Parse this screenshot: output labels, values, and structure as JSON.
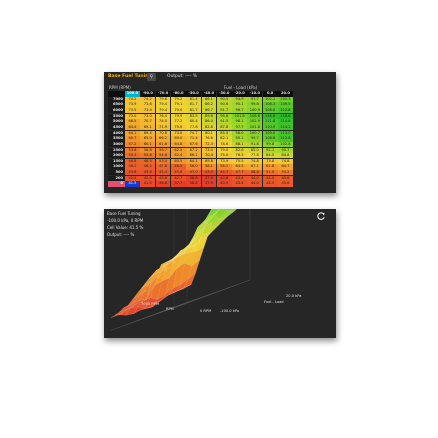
{
  "table": {
    "title": "Base Fuel Tuning",
    "output_label": "Output: ---- %",
    "rpm_axis_label": "RPM (RPM)",
    "load_axis_label": "Fuel - Load (kPa)",
    "columns": [
      "100.0",
      "-90.0",
      "-70.0",
      "-60.0",
      "-50.0",
      "-40.0",
      "-30.0",
      "-20.0",
      "-10.0",
      "0.0",
      "20.0"
    ],
    "selected_column": 0,
    "selected_row": 15,
    "rows": [
      {
        "rpm": "7000",
        "values": [
          "74.2",
          "74.2",
          "79.8",
          "79.2",
          "81.4",
          "86.1",
          "90.5",
          "94.9",
          "97.7",
          "102.2",
          "105.3"
        ]
      },
      {
        "rpm": "6500",
        "values": [
          "73.9",
          "73.8",
          "79.4",
          "79.1",
          "81.7",
          "86.2",
          "90.6",
          "95.1",
          "99.8",
          "108.3",
          "109.5"
        ]
      },
      {
        "rpm": "6000",
        "values": [
          "73.5",
          "73.4",
          "79.4",
          "79.0",
          "81.7",
          "86.7",
          "91.7",
          "96.7",
          "100.9",
          "108.8",
          "112.8"
        ]
      },
      {
        "rpm": "5500",
        "values": [
          "73.0",
          "73.0",
          "76.4",
          "79.9",
          "83.5",
          "89.6",
          "95.6",
          "101.8",
          "106.8",
          "116.8",
          "118.6"
        ]
      },
      {
        "rpm": "5000",
        "values": [
          "66.5",
          "70.7",
          "74.0",
          "77.2",
          "80.4",
          "86.0",
          "91.5",
          "98.1",
          "102.9",
          "111.8",
          "114.8"
        ]
      },
      {
        "rpm": "4500",
        "values": [
          "64.4",
          "69.1",
          "71.9",
          "75.0",
          "77.8",
          "82.8",
          "87.8",
          "97.7",
          "101.8",
          "110.9",
          "114.2"
        ]
      },
      {
        "rpm": "4000",
        "values": [
          "64.1",
          "69.4",
          "70.8",
          "73.0",
          "74.7",
          "80.1",
          "85.5",
          "96.0",
          "100.7",
          "109.0",
          "113.0"
        ]
      },
      {
        "rpm": "3500",
        "values": [
          "60.7",
          "65.0",
          "66.2",
          "69.0",
          "71.4",
          "76.6",
          "82.1",
          "95.1",
          "99.7",
          "108.8",
          "112.8"
        ]
      },
      {
        "rpm": "3000",
        "values": [
          "57.2",
          "60.1",
          "61.6",
          "64.8",
          "67.6",
          "72.3",
          "78.6",
          "88.1",
          "91.8",
          "99.8",
          "102.8"
        ]
      },
      {
        "rpm": "2500",
        "values": [
          "53.8",
          "58.8",
          "58.7",
          "62.5",
          "67.2",
          "73.0",
          "79.0",
          "82.6",
          "85.0",
          "92.1",
          "95.7"
        ]
      },
      {
        "rpm": "2000",
        "values": [
          "50.3",
          "52.8",
          "54.8",
          "62.4",
          "66.1",
          "70.4",
          "75.0",
          "76.5",
          "77.8",
          "84.5",
          "84.8"
        ]
      },
      {
        "rpm": "1500",
        "values": [
          "46.8",
          "48.5",
          "53.0",
          "60.5",
          "64.1",
          "69.8",
          "73.9",
          "75.5",
          "74.8",
          "73.8",
          "74.8"
        ]
      },
      {
        "rpm": "1000",
        "values": [
          "46.2",
          "46.2",
          "47.8",
          "46.5",
          "56.0",
          "58.1",
          "58.2",
          "64.5",
          "67.1",
          "61.8",
          "64.7"
        ]
      },
      {
        "rpm": "500",
        "values": [
          "43.8",
          "43.8",
          "45.4",
          "45.8",
          "47.0",
          "43.0",
          "44.7",
          "47.7",
          "48.8",
          "51.0",
          "54.2"
        ]
      },
      {
        "rpm": "200",
        "values": [
          "42.4",
          "42.4",
          "43.8",
          "42.7",
          "38.8",
          "37.9",
          "40.8",
          "43.4",
          "44.0",
          "44.5",
          "45.6"
        ]
      },
      {
        "rpm": "0",
        "values": [
          "41.5",
          "41.5",
          "38.8",
          "37.7",
          "38.8",
          "37.9",
          "40.9",
          "43.4",
          "44.0",
          "44.5",
          "45.6"
        ]
      }
    ]
  },
  "view": {
    "title": "Base Fuel Tuning",
    "position": "-100.0 kPa, 0 RPM",
    "cell_value": "Cell Value: 41.5 %",
    "output": "Output: ---- %",
    "reset_icon": "refresh-icon",
    "axis_rpm_max": "7000 RPM",
    "axis_rpm_title": "RPM",
    "axis_rpm_min": "0 RPM",
    "axis_kpa_min": "-100.0 kPa",
    "axis_kpa_max": "20.0 kPa",
    "axis_load_title": "Fuel - Load"
  },
  "colors": {
    "panel_bg": "#262626",
    "title_accent": "#f0b400",
    "selected_column": "#00b0d0",
    "selected_row": "#e05070",
    "selected_cell": "#1838d0"
  }
}
